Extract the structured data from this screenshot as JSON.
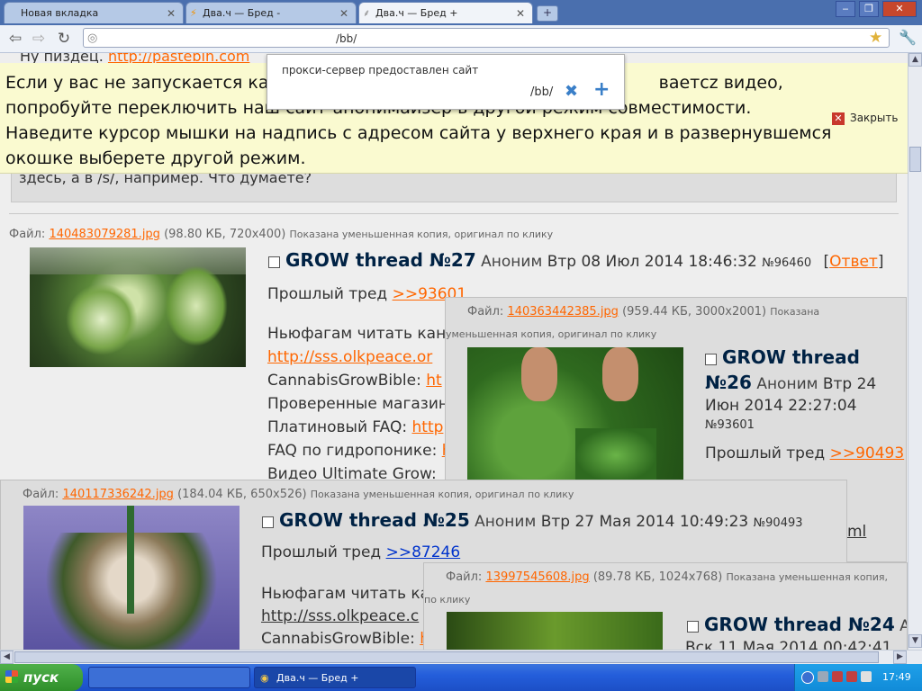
{
  "browser": {
    "tabs": [
      {
        "label": "Новая вкладка",
        "active": false
      },
      {
        "label": "Два.ч — Бред -",
        "active": false
      },
      {
        "label": "Два.ч — Бред +",
        "active": true
      }
    ],
    "address": "/bb/",
    "close_glyph": "✕",
    "new_tab_glyph": "+",
    "window_buttons": {
      "minimize": "‒",
      "maximize": "❐",
      "close": "✕"
    }
  },
  "notice": {
    "text": "Если у вас не запускается кака… видео, попробуйте переключить наш сайт-анонимайзер в другой режим совместимости. Наведите курсор мышки на надпись с адресом сайта у верхнего края и в развернувшемся окошке выберете другой режим.",
    "text_start": "Если у вас не запускается кака",
    "text_end": "ваетcz видео,",
    "text_rest": "попробуйте переключить наш сайт-анонимайзер в другой режим совместимости. Наведите курсор мышки на надпись с адресом сайта у верхнего края и в развернувшемся окошке выберете другой режим.",
    "close_label": "Закрыть",
    "close_glyph": "✕"
  },
  "popup": {
    "line1": "прокси-сервер предоставлен сайт",
    "line2": "/bb/",
    "remove_glyph": "✖",
    "add_glyph": "+"
  },
  "top_post": {
    "line1_prefix": "Ну пиздец.",
    "line1_link": "http://pastebin.com",
    "line2": "здесь, а в /s/, например. Что думаете?"
  },
  "posts": [
    {
      "file_label": "Файл:",
      "file_name": "140483079281.jpg",
      "file_info": "(98.80 КБ, 720x400)",
      "thumb_note": "Показана уменьшенная копия, оригинал по клику",
      "subject": "GROW thread №27",
      "poster": "Аноним",
      "date": "Втр 08 Июл 2014 18:46:32",
      "num": "№96460",
      "reply_open": "[",
      "reply": "Ответ",
      "reply_close": "]",
      "prev_label": "Прошлый тред",
      "prev_link": ">>93601",
      "lines": [
        {
          "text": "Ньюфагам читать кан",
          "link": ""
        },
        {
          "text": "",
          "link": "http://sss.olkpeace.or"
        },
        {
          "text": "CannabisGrowBible:",
          "link": "ht"
        },
        {
          "text": "Проверенные магазин",
          "link": ""
        },
        {
          "text": "Платиновый FAQ:",
          "link": "http"
        },
        {
          "text": "FAQ по гидропонике:",
          "link": "h"
        },
        {
          "text": "Видео Ultimate Grow:",
          "link": ""
        }
      ]
    },
    {
      "file_label": "Файл:",
      "file_name": "140363442385.jpg",
      "file_info": "(959.44 КБ, 3000x2001)",
      "thumb_note_a": "Показана",
      "thumb_note_b": "уменьшенная копия, оригинал по клику",
      "subject_a": "GROW thread",
      "subject_b": "№26",
      "poster": "Аноним",
      "date_a": "Втр 24",
      "date_b": "Июн 2014 22:27:04",
      "num": "№93601",
      "prev_label": "Прошлый тред",
      "prev_link": ">>90493",
      "tail_link": "ml"
    },
    {
      "file_label": "Файл:",
      "file_name": "140117336242.jpg",
      "file_info": "(184.04 КБ, 650x526)",
      "thumb_note": "Показана уменьшенная копия, оригинал по клику",
      "subject": "GROW thread №25",
      "poster": "Аноним",
      "date": "Втр 27 Мая 2014 10:49:23",
      "num": "№90493",
      "prev_label": "Прошлый тред",
      "prev_link": ">>87246",
      "line_a": "Ньюфагам читать ка",
      "line_b_link": "http://sss.olkpeace.c",
      "line_c": "CannabisGrowBible:",
      "line_c_link": "h"
    },
    {
      "file_label": "Файл:",
      "file_name": "13997545608.jpg",
      "file_info": "(89.78 КБ, 1024x768)",
      "thumb_note_a": "Показана уменьшенная копия,",
      "thumb_note_b": "по клику",
      "subject": "GROW thread №24",
      "poster": "Ан",
      "date": "Вск 11 Мая 2014 00:42:41"
    }
  ],
  "taskbar": {
    "start_label": "пуск",
    "window_item": "Два.ч — Бред +",
    "clock": "17:49"
  }
}
